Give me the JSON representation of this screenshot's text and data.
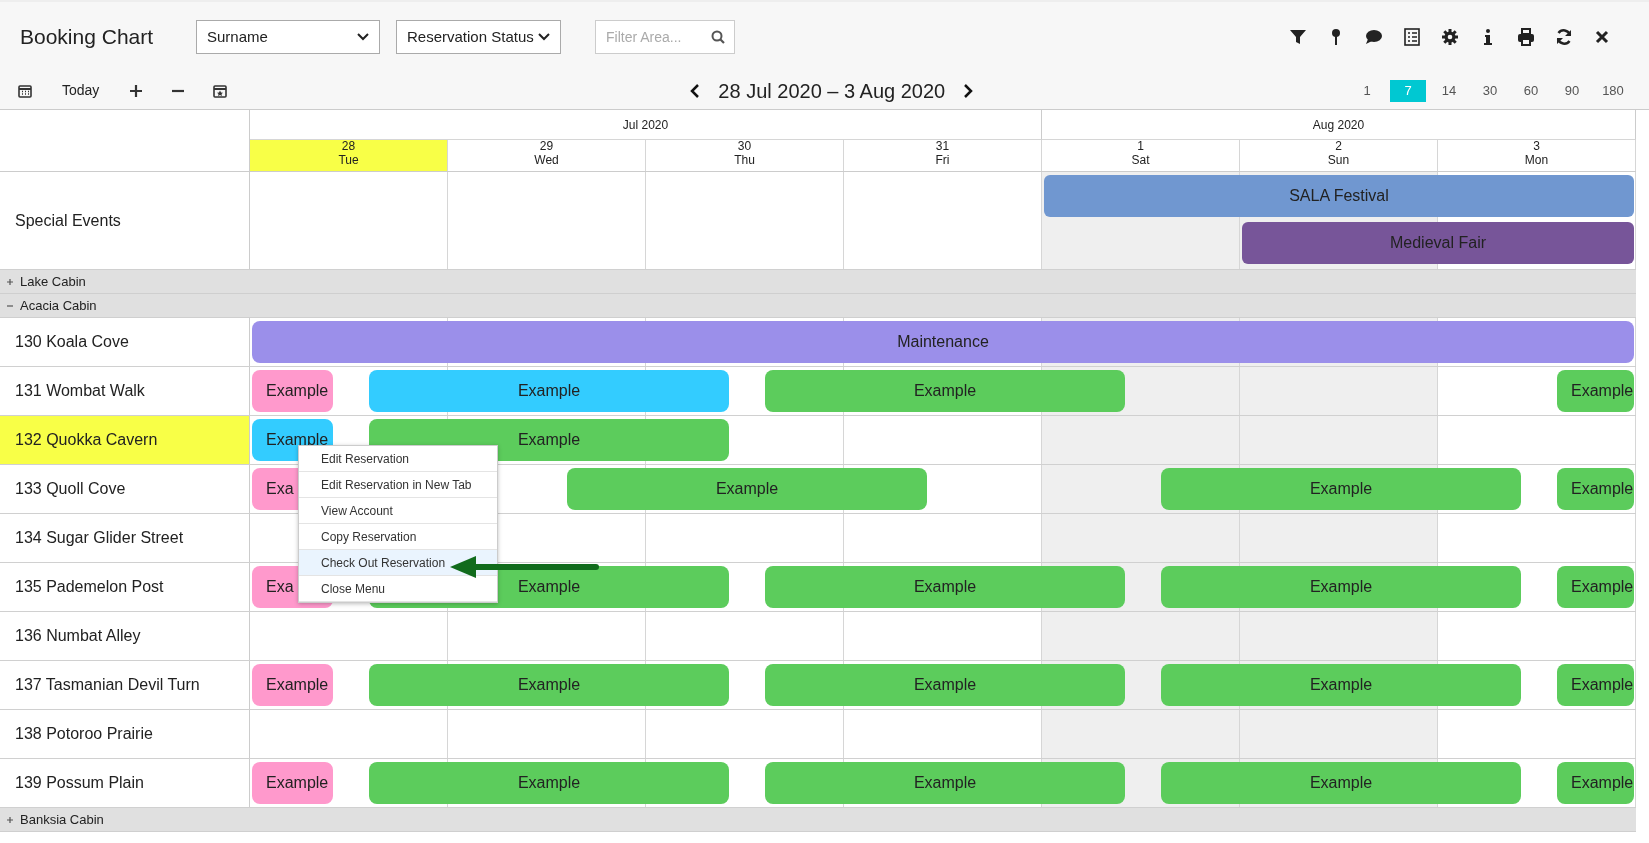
{
  "title": "Booking Chart",
  "filters": [
    {
      "kind": "select",
      "value": "Surname"
    },
    {
      "kind": "select",
      "value": "Reservation Status"
    },
    {
      "kind": "search",
      "placeholder": "Filter Area..."
    }
  ],
  "toolbar": {
    "today": "Today",
    "range": "28 Jul 2020 – 3 Aug 2020",
    "spans": [
      {
        "label": "1",
        "selected": false
      },
      {
        "label": "7",
        "selected": true
      },
      {
        "label": "14",
        "selected": false
      },
      {
        "label": "30",
        "selected": false
      },
      {
        "label": "60",
        "selected": false
      },
      {
        "label": "90",
        "selected": false
      },
      {
        "label": "180",
        "selected": false
      }
    ]
  },
  "months": [
    {
      "label": "Jul 2020",
      "days": [
        {
          "day": "28",
          "weekday": "Tue",
          "today": true,
          "weekend": false
        },
        {
          "day": "29",
          "weekday": "Wed",
          "today": false,
          "weekend": false
        },
        {
          "day": "30",
          "weekday": "Thu",
          "today": false,
          "weekend": false
        },
        {
          "day": "31",
          "weekday": "Fri",
          "today": false,
          "weekend": false
        }
      ]
    },
    {
      "label": "Aug 2020",
      "days": [
        {
          "day": "1",
          "weekday": "Sat",
          "today": false,
          "weekend": true
        },
        {
          "day": "2",
          "weekday": "Sun",
          "today": false,
          "weekend": true
        },
        {
          "day": "3",
          "weekday": "Mon",
          "today": false,
          "weekend": false
        }
      ]
    }
  ],
  "special_events": {
    "label": "Special Events",
    "lanes": [
      {
        "items": [
          {
            "kind": "gap"
          },
          {
            "kind": "gap"
          },
          {
            "kind": "gap"
          },
          {
            "kind": "gap"
          },
          {
            "kind": "three_day",
            "name": "SALA Festival",
            "color": "#7097d0"
          }
        ]
      },
      {
        "items": [
          {
            "kind": "gap"
          },
          {
            "kind": "gap"
          },
          {
            "kind": "gap"
          },
          {
            "kind": "gap"
          },
          {
            "kind": "gap"
          },
          {
            "kind": "two_day",
            "name": "Medieval Fair",
            "color": "#775599"
          }
        ]
      }
    ]
  },
  "groups": [
    {
      "name": "Lake Cabin",
      "expanded": false
    },
    {
      "name": "Acacia Cabin",
      "expanded": true,
      "rooms": [
        {
          "name": "130 Koala Cove",
          "selected": false,
          "slots": [
            {
              "kind": "block",
              "label": "Maintenance",
              "color": "#9b8fea"
            }
          ]
        },
        {
          "name": "131 Wombat Walk",
          "selected": false,
          "slots": [
            {
              "kind": "departure",
              "label": "Example",
              "color": "#ff99cc"
            },
            {
              "kind": "two_nights",
              "label": "Example",
              "color": "#33ccff"
            },
            {
              "kind": "two_nights",
              "label": "Example",
              "color": "#5ccc5c"
            },
            {
              "kind": "gap"
            },
            {
              "kind": "gap"
            },
            {
              "kind": "gap"
            },
            {
              "kind": "gap"
            },
            {
              "kind": "arrival",
              "label": "Example",
              "color": "#5ccc5c"
            }
          ]
        },
        {
          "name": "132 Quokka Cavern",
          "selected": true,
          "slots": [
            {
              "kind": "departure",
              "label": "Example",
              "color": "#33ccff"
            },
            {
              "kind": "two_nights",
              "label": "Example",
              "color": "#5ccc5c"
            }
          ]
        },
        {
          "name": "133 Quoll Cove",
          "selected": false,
          "slots": [
            {
              "kind": "departure",
              "label": "Exa",
              "color": "#ff99cc"
            },
            {
              "kind": "gap"
            },
            {
              "kind": "gap"
            },
            {
              "kind": "two_nights",
              "label": "Example",
              "color": "#5ccc5c"
            },
            {
              "kind": "gap"
            },
            {
              "kind": "gap"
            },
            {
              "kind": "two_nights",
              "label": "Example",
              "color": "#5ccc5c"
            },
            {
              "kind": "arrival",
              "label": "Example",
              "color": "#5ccc5c"
            }
          ]
        },
        {
          "name": "134 Sugar Glider Street",
          "selected": false
        },
        {
          "name": "135 Pademelon Post",
          "selected": false,
          "slots": [
            {
              "kind": "departure",
              "label": "Exa",
              "color": "#ff99cc"
            },
            {
              "kind": "two_nights",
              "label": "Example",
              "color": "#5ccc5c"
            },
            {
              "kind": "two_nights",
              "label": "Example",
              "color": "#5ccc5c"
            },
            {
              "kind": "two_nights",
              "label": "Example",
              "color": "#5ccc5c"
            },
            {
              "kind": "arrival",
              "label": "Example",
              "color": "#5ccc5c"
            }
          ]
        },
        {
          "name": "136 Numbat Alley",
          "selected": false
        },
        {
          "name": "137 Tasmanian Devil Turn",
          "selected": false,
          "slots": [
            {
              "kind": "departure",
              "label": "Example",
              "color": "#ff99cc"
            },
            {
              "kind": "two_nights",
              "label": "Example",
              "color": "#5ccc5c"
            },
            {
              "kind": "two_nights",
              "label": "Example",
              "color": "#5ccc5c"
            },
            {
              "kind": "two_nights",
              "label": "Example",
              "color": "#5ccc5c"
            },
            {
              "kind": "arrival",
              "label": "Example",
              "color": "#5ccc5c"
            }
          ]
        },
        {
          "name": "138 Potoroo Prairie",
          "selected": false
        },
        {
          "name": "139 Possum Plain",
          "selected": false,
          "slots": [
            {
              "kind": "departure",
              "label": "Example",
              "color": "#ff99cc"
            },
            {
              "kind": "two_nights",
              "label": "Example",
              "color": "#5ccc5c"
            },
            {
              "kind": "two_nights",
              "label": "Example",
              "color": "#5ccc5c"
            },
            {
              "kind": "two_nights",
              "label": "Example",
              "color": "#5ccc5c"
            },
            {
              "kind": "arrival",
              "label": "Example",
              "color": "#5ccc5c"
            }
          ]
        }
      ]
    },
    {
      "name": "Banksia Cabin",
      "expanded": false
    }
  ],
  "context_menu": {
    "items": [
      {
        "label": "Edit Reservation",
        "selected": false
      },
      {
        "label": "Edit Reservation in New Tab",
        "selected": false
      },
      {
        "label": "View Account",
        "selected": false
      },
      {
        "label": "Copy Reservation",
        "selected": false
      },
      {
        "label": "Check Out Reservation",
        "selected": true
      },
      {
        "label": "Close Menu",
        "selected": false
      }
    ]
  }
}
